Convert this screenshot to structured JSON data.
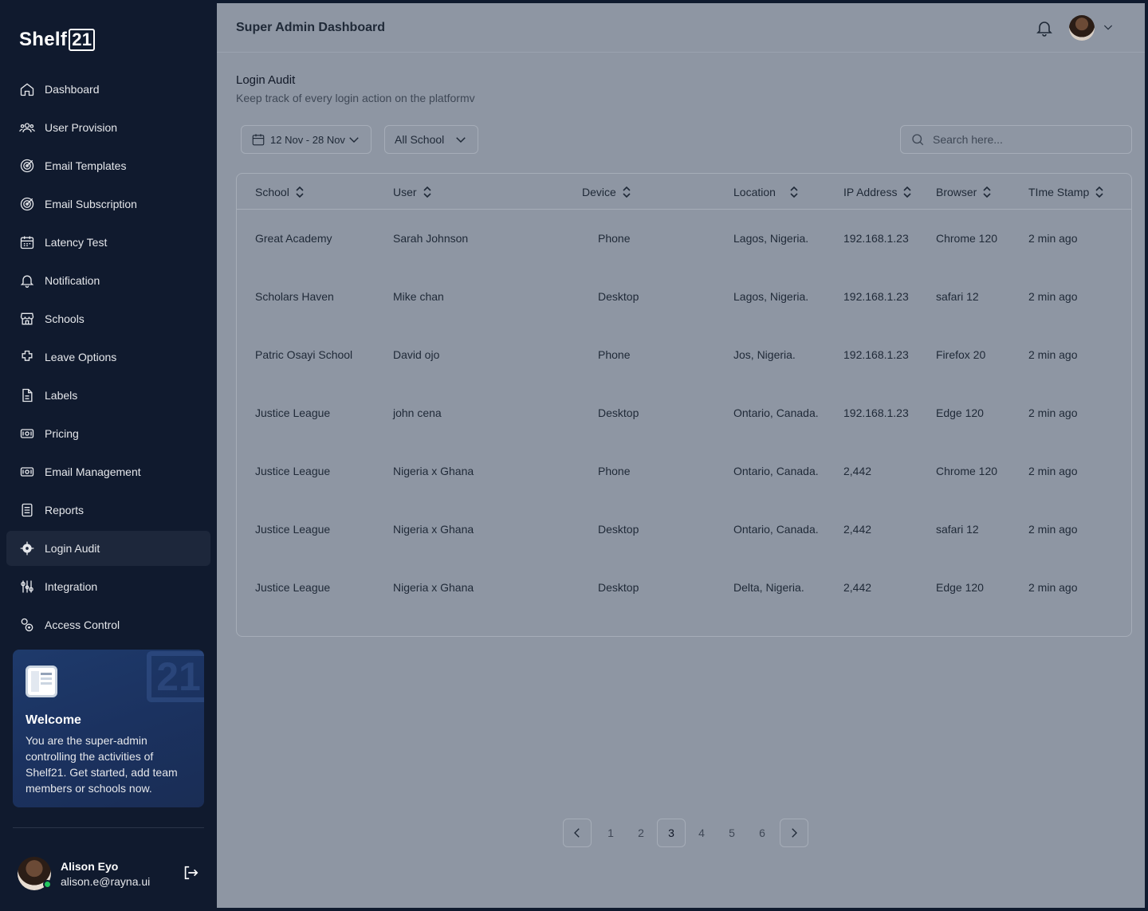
{
  "brand": {
    "name": "Shelf",
    "num": "21"
  },
  "sidebar": {
    "items": [
      {
        "label": "Dashboard",
        "icon": "home-icon"
      },
      {
        "label": "User Provision",
        "icon": "users-icon"
      },
      {
        "label": "Email Templates",
        "icon": "target-icon"
      },
      {
        "label": "Email Subscription",
        "icon": "target-icon"
      },
      {
        "label": "Latency Test",
        "icon": "calendar-icon"
      },
      {
        "label": "Notification",
        "icon": "bell-icon"
      },
      {
        "label": "Schools",
        "icon": "store-icon"
      },
      {
        "label": "Leave Options",
        "icon": "puzzle-icon"
      },
      {
        "label": "Labels",
        "icon": "file-icon"
      },
      {
        "label": "Pricing",
        "icon": "money-icon"
      },
      {
        "label": "Email Management",
        "icon": "money-icon"
      },
      {
        "label": "Reports",
        "icon": "report-icon"
      },
      {
        "label": "Login Audit",
        "icon": "gear-icon"
      },
      {
        "label": "Integration",
        "icon": "sliders-icon"
      },
      {
        "label": "Access Control",
        "icon": "access-icon"
      }
    ],
    "active": "Login Audit"
  },
  "welcome": {
    "title": "Welcome",
    "text": "You are the super-admin controlling the activities of Shelf21. Get started, add team members or schools now."
  },
  "user": {
    "name": "Alison Eyo",
    "email": "alison.e@rayna.ui"
  },
  "header": {
    "title": "Super Admin Dashboard"
  },
  "page": {
    "title": "Login Audit",
    "subtitle": "Keep track of every login action on the platformv"
  },
  "filters": {
    "date_range": "12 Nov - 28 Nov",
    "school": "All School",
    "search_placeholder": "Search here..."
  },
  "table": {
    "columns": [
      "School",
      "User",
      "Device",
      "Location",
      "IP Address",
      "Browser",
      "TIme Stamp"
    ],
    "rows": [
      [
        "Great Academy",
        "Sarah Johnson",
        "Phone",
        "Lagos, Nigeria.",
        "192.168.1.23",
        "Chrome 120",
        "2 min ago"
      ],
      [
        "Scholars Haven",
        "Mike chan",
        "Desktop",
        "Lagos, Nigeria.",
        "192.168.1.23",
        "safari 12",
        "2 min ago"
      ],
      [
        "Patric Osayi School",
        "David ojo",
        "Phone",
        "Jos, Nigeria.",
        "192.168.1.23",
        "Firefox 20",
        "2 min ago"
      ],
      [
        "Justice League",
        "john cena",
        "Desktop",
        "Ontario, Canada.",
        "192.168.1.23",
        "Edge 120",
        "2 min ago"
      ],
      [
        "Justice League",
        "Nigeria x Ghana",
        "Phone",
        "Ontario, Canada.",
        "2,442",
        "Chrome 120",
        "2 min ago"
      ],
      [
        "Justice League",
        "Nigeria x Ghana",
        "Desktop",
        "Ontario, Canada.",
        "2,442",
        "safari 12",
        "2 min ago"
      ],
      [
        "Justice League",
        "Nigeria x Ghana",
        "Desktop",
        "Delta, Nigeria.",
        "2,442",
        "Edge 120",
        "2 min ago"
      ]
    ]
  },
  "pagination": {
    "pages": [
      "1",
      "2",
      "3",
      "4",
      "5",
      "6"
    ],
    "current": "3"
  }
}
